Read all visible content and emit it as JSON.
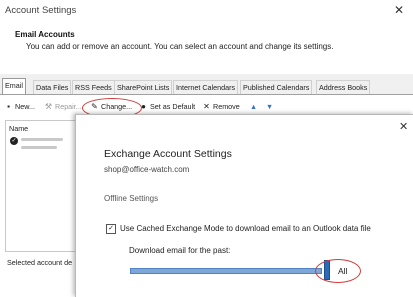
{
  "window": {
    "title": "Account Settings",
    "close": "✕"
  },
  "header": {
    "title": "Email Accounts",
    "subtitle": "You can add or remove an account. You can select an account and change its settings."
  },
  "tabs": [
    {
      "label": "Email",
      "active": true
    },
    {
      "label": "Data Files"
    },
    {
      "label": "RSS Feeds"
    },
    {
      "label": "SharePoint Lists"
    },
    {
      "label": "Internet Calendars"
    },
    {
      "label": "Published Calendars"
    },
    {
      "label": "Address Books"
    }
  ],
  "toolbar": {
    "new": "New...",
    "repair": "Repair...",
    "change": "Change...",
    "set_default": "Set as Default",
    "remove": "Remove",
    "up_icon": "arrow-up-icon",
    "down_icon": "arrow-down-icon"
  },
  "account_list": {
    "header": "Name"
  },
  "selected_account_label": "Selected account de",
  "dialog": {
    "title": "Exchange Account Settings",
    "email": "shop@office-watch.com",
    "section": "Offline Settings",
    "cached_mode_label": "Use Cached Exchange Mode to download email to an Outlook data file",
    "cached_mode_checked": true,
    "download_label": "Download email for the past:",
    "download_value": "All",
    "close": "✕"
  },
  "colors": {
    "annotation_circle": "#d23b3b",
    "slider": "#2b6ab7"
  }
}
